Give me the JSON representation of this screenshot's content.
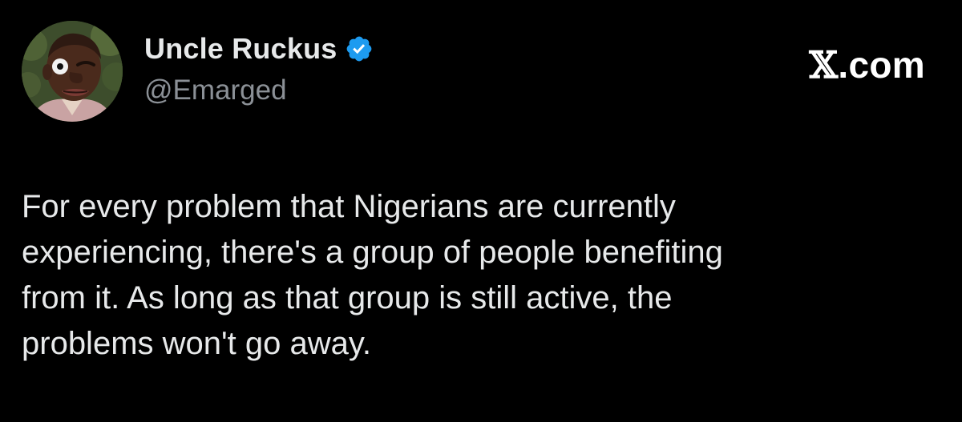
{
  "author": {
    "display_name": "Uncle Ruckus",
    "handle": "@Emarged",
    "verified": true,
    "avatar_icon": "cartoon-portrait-avatar"
  },
  "site": {
    "label_x": "𝕏",
    "label_rest": ".com"
  },
  "tweet": {
    "lines": [
      "For every problem that Nigerians are currently",
      "experiencing, there's a group of people benefiting",
      "from it. As long as that group is still active, the",
      "problems won't go away."
    ]
  },
  "colors": {
    "background": "#000000",
    "primary_text": "#e7e9ea",
    "secondary_text": "#8b9096",
    "verified_blue": "#1d9bf0"
  }
}
